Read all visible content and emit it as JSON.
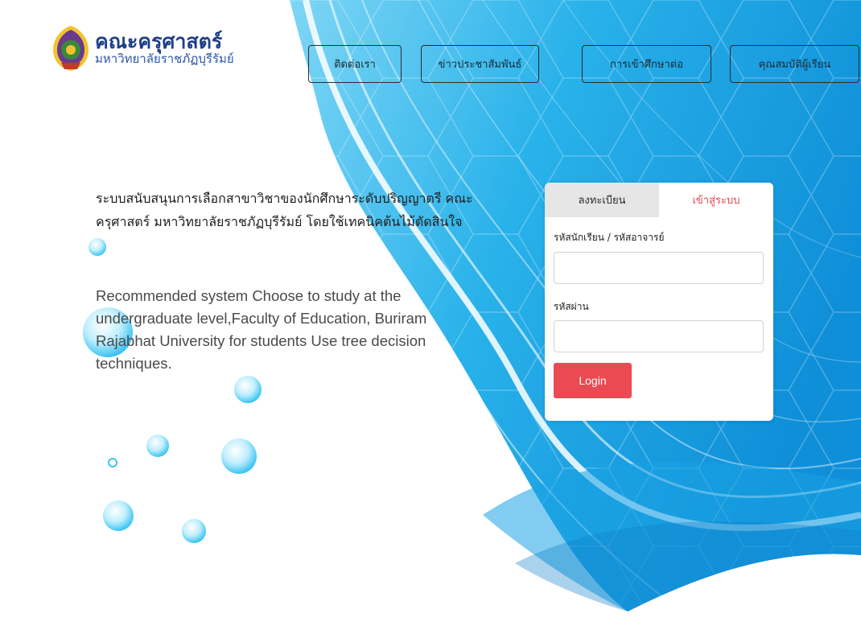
{
  "brand": {
    "title": "คณะครุศาสตร์",
    "subtitle": "มหาวิทยาลัยราชภัฏบุรีรัมย์",
    "seal_icon": "university-seal-icon"
  },
  "nav": {
    "contact": "ติดต่อเรา",
    "news": "ข่าวประชาสัมพันธ์",
    "admission": "การเข้าศึกษาต่อ",
    "qualification": "คุณสมบัติผู้เรียน"
  },
  "intro": {
    "thai": "ระบบสนับสนุนการเลือกสาขาวิชาของนักศึกษาระดับปริญญาตรี คณะครุศาสตร์ มหาวิทยาลัยราชภัฏบุรีรัมย์ โดยใช้เทคนิคต้นไม้ตัดสินใจ",
    "english": "Recommended system Choose to study at the undergraduate level,Faculty of Education, Buriram Rajabhat University for students Use tree decision techniques."
  },
  "login_card": {
    "tabs": {
      "register": "ลงทะเบียน",
      "login": "เข้าสู่ระบบ"
    },
    "username_label": "รหัสนักเรียน / รหัสอาจารย์",
    "username_value": "",
    "password_label": "รหัสผ่าน",
    "password_value": "",
    "submit_label": "Login"
  },
  "colors": {
    "accent": "#ea4a52",
    "brand_blue": "#1f3f8a",
    "sky": "#29b6ec"
  }
}
